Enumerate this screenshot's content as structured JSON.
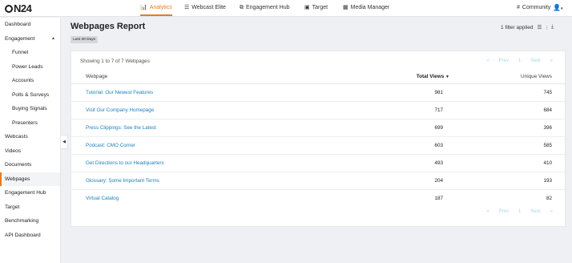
{
  "topbar": {
    "logo": "N24",
    "nav": [
      {
        "label": "Analytics",
        "icon": "bar-chart-icon"
      },
      {
        "label": "Webcast Elite",
        "icon": "list-icon"
      },
      {
        "label": "Engagement Hub",
        "icon": "hub-icon"
      },
      {
        "label": "Target",
        "icon": "target-icon"
      },
      {
        "label": "Media Manager",
        "icon": "grid-icon"
      }
    ],
    "community": "Community",
    "accent": "#ea7a20"
  },
  "sidebar": {
    "items": [
      {
        "label": "Dashboard"
      },
      {
        "label": "Engagement"
      },
      {
        "label": "Funnel"
      },
      {
        "label": "Power Leads"
      },
      {
        "label": "Accounts"
      },
      {
        "label": "Polls & Surveys"
      },
      {
        "label": "Buying Signals"
      },
      {
        "label": "Presenters"
      },
      {
        "label": "Webcasts"
      },
      {
        "label": "Videos"
      },
      {
        "label": "Documents"
      },
      {
        "label": "Webpages"
      },
      {
        "label": "Engagement Hub"
      },
      {
        "label": "Target"
      },
      {
        "label": "Benchmarking"
      },
      {
        "label": "API Dashboard"
      }
    ],
    "active": "Webpages"
  },
  "main": {
    "title": "Webpages Report",
    "date_chip": "Last 30 Days",
    "filter_text": "1 filter applied",
    "showing": "Showing 1 to 7 of 7 Webpages",
    "pager": {
      "prev": "Prev",
      "page": "1",
      "next": "Next"
    },
    "columns": {
      "webpage": "Webpage",
      "total_views": "Total Views",
      "unique_views": "Unique Views"
    },
    "rows": [
      {
        "webpage": "Tutorial:  Our Newest Features",
        "total": "981",
        "unique": "745"
      },
      {
        "webpage": "Visit Our Company Homepage",
        "total": "717",
        "unique": "684"
      },
      {
        "webpage": "Press Clippings:  See the Latest",
        "total": "699",
        "unique": "396"
      },
      {
        "webpage": "Podcast:  CMO Corner",
        "total": "603",
        "unique": "585"
      },
      {
        "webpage": "Get Directions to our Headquarters",
        "total": "493",
        "unique": "410"
      },
      {
        "webpage": "Glossary:  Some Important Terms",
        "total": "204",
        "unique": "193"
      },
      {
        "webpage": "Virtual Catalog",
        "total": "187",
        "unique": "82"
      }
    ]
  }
}
